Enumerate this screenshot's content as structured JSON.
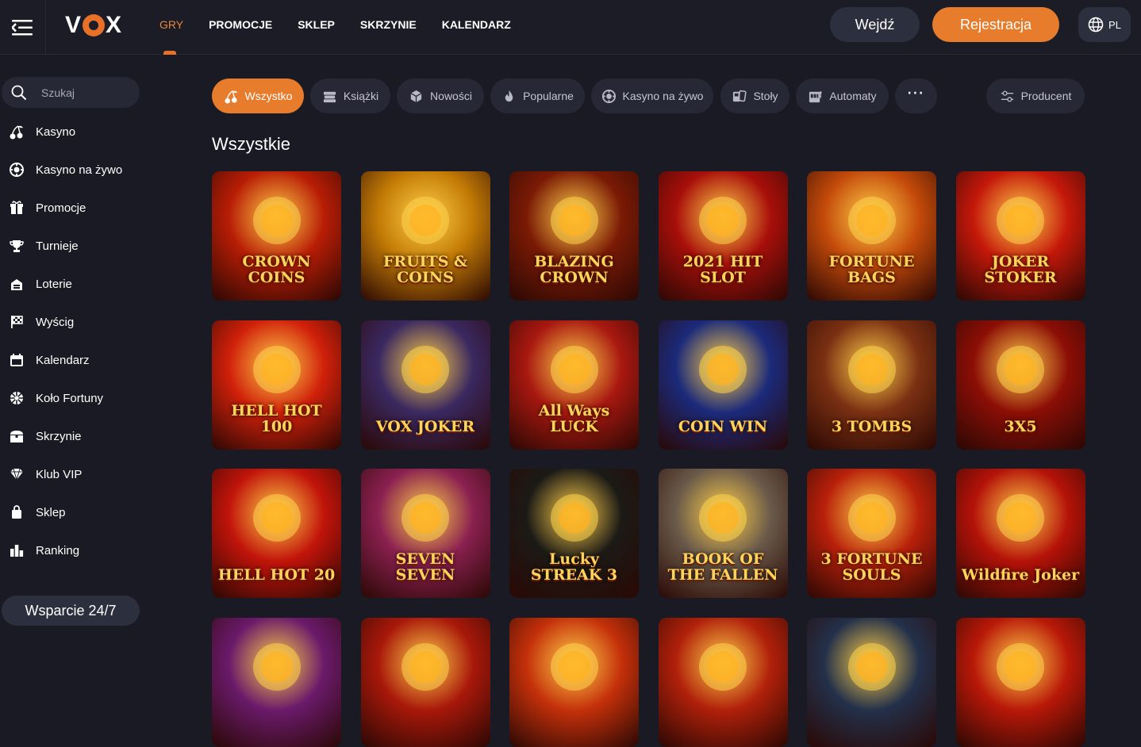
{
  "header": {
    "logo_text": "VOX",
    "nav": [
      "GRY",
      "PROMOCJE",
      "SKLEP",
      "SKRZYNIE",
      "KALENDARZ"
    ],
    "login_label": "Wejdź",
    "register_label": "Rejestracja",
    "lang": "PL"
  },
  "sidebar": {
    "search_placeholder": "Szukaj",
    "items": [
      {
        "label": "Kasyno",
        "icon": "cherries-icon"
      },
      {
        "label": "Kasyno na żywo",
        "icon": "chip-icon"
      },
      {
        "label": "Promocje",
        "icon": "gift-icon"
      },
      {
        "label": "Turnieje",
        "icon": "trophy-icon"
      },
      {
        "label": "Loterie",
        "icon": "lottery-icon"
      },
      {
        "label": "Wyścig",
        "icon": "race-flag-icon"
      },
      {
        "label": "Kalendarz",
        "icon": "calendar-icon"
      },
      {
        "label": "Koło Fortuny",
        "icon": "wheel-icon"
      },
      {
        "label": "Skrzynie",
        "icon": "chest-icon"
      },
      {
        "label": "Klub VIP",
        "icon": "diamond-icon"
      },
      {
        "label": "Sklep",
        "icon": "shopping-bag-icon"
      },
      {
        "label": "Ranking",
        "icon": "ranking-icon"
      }
    ],
    "support_label": "Wsparcie 24/7"
  },
  "filters": [
    {
      "label": "Wszystko",
      "icon": "cherries-icon",
      "active": true
    },
    {
      "label": "Książki",
      "icon": "books-icon"
    },
    {
      "label": "Nowości",
      "icon": "new-cube-icon"
    },
    {
      "label": "Popularne",
      "icon": "fire-icon"
    },
    {
      "label": "Kasyno na żywo",
      "icon": "chip-icon"
    },
    {
      "label": "Stoły",
      "icon": "table-cards-icon"
    },
    {
      "label": "Automaty",
      "icon": "slot-machine-icon"
    },
    {
      "label": "⋯",
      "icon": "more-icon"
    },
    {
      "label": "Producent",
      "icon": "filter-sliders-icon"
    }
  ],
  "section_title": "Wszystkie",
  "games": [
    {
      "name": "CROWN COINS",
      "bg": "#b81d05"
    },
    {
      "name": "FRUITS & COINS",
      "bg": "#c27a05"
    },
    {
      "name": "BLAZING CROWN",
      "bg": "#7a1a05"
    },
    {
      "name": "2021 HIT SLOT",
      "bg": "#a80f0a"
    },
    {
      "name": "FORTUNE BAGS",
      "bg": "#c44a0a"
    },
    {
      "name": "JOKER STOKER",
      "bg": "#c4180a"
    },
    {
      "name": "HELL HOT 100",
      "bg": "#d0200a"
    },
    {
      "name": "VOX JOKER",
      "bg": "#3a2860"
    },
    {
      "name": "All Ways LUCK",
      "bg": "#a81810"
    },
    {
      "name": "COIN WIN",
      "bg": "#1b2a7a"
    },
    {
      "name": "3 TOMBS",
      "bg": "#7a3012"
    },
    {
      "name": "3X5",
      "bg": "#8c0e06"
    },
    {
      "name": "HELL HOT 20",
      "bg": "#c1140a"
    },
    {
      "name": "SEVEN SEVEN",
      "bg": "#8a2050"
    },
    {
      "name": "Lucky STREAK 3",
      "bg": "#1c1a16"
    },
    {
      "name": "BOOK OF THE FALLEN",
      "bg": "#6a5a4a"
    },
    {
      "name": "3 FORTUNE SOULS",
      "bg": "#b8200a"
    },
    {
      "name": "Wildfire Joker",
      "bg": "#b41208"
    },
    {
      "name": "",
      "bg": "#6a1a6a"
    },
    {
      "name": "",
      "bg": "#a8180a"
    },
    {
      "name": "",
      "bg": "#c4300a"
    },
    {
      "name": "",
      "bg": "#b0200a"
    },
    {
      "name": "",
      "bg": "#23304a"
    },
    {
      "name": "",
      "bg": "#b81808"
    }
  ]
}
